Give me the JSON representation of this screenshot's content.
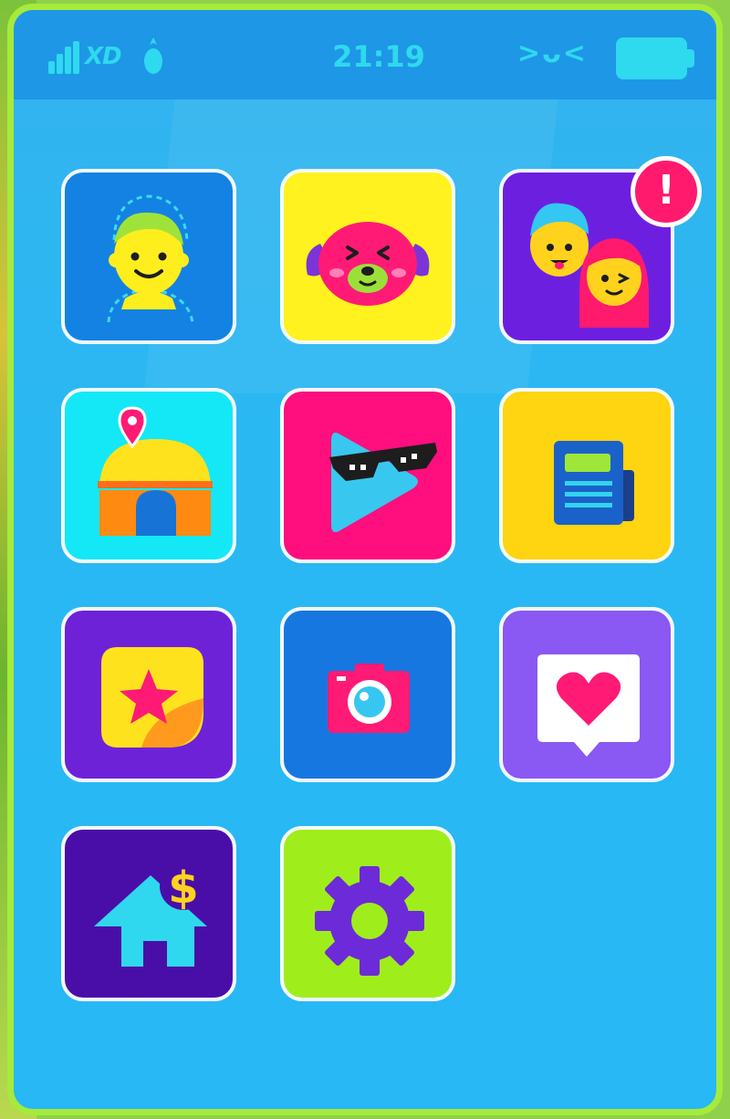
{
  "status_bar": {
    "carrier": "XD",
    "time": "21:19",
    "face": ">ᴗ<",
    "icons": [
      "signal-icon",
      "pineapple-icon",
      "battery-icon"
    ]
  },
  "apps": [
    {
      "name": "avatar-creator",
      "icon": "face-outline-icon",
      "bg": "#1482e2"
    },
    {
      "name": "pets",
      "icon": "pink-dog-icon",
      "bg": "#fff21e"
    },
    {
      "name": "friends",
      "icon": "two-kids-icon",
      "bg": "#6d1fe0",
      "badge": "!"
    },
    {
      "name": "house-map",
      "icon": "dome-house-pin-icon",
      "bg": "#14e8f6"
    },
    {
      "name": "video",
      "icon": "play-sunglasses-icon",
      "bg": "#ff0e7e"
    },
    {
      "name": "news",
      "icon": "newspaper-icon",
      "bg": "#ffd410"
    },
    {
      "name": "favorites",
      "icon": "star-sticker-icon",
      "bg": "#6e22d8"
    },
    {
      "name": "camera",
      "icon": "camera-icon",
      "bg": "#1777e0"
    },
    {
      "name": "likes",
      "icon": "heart-bubble-icon",
      "bg": "#8a58f2"
    },
    {
      "name": "real-estate",
      "icon": "house-dollar-icon",
      "bg": "#4a0ea8"
    },
    {
      "name": "settings",
      "icon": "gear-icon",
      "bg": "#9fee1c"
    }
  ],
  "colors": {
    "screen": "#27b8f5",
    "status_bar": "#1e97e6",
    "frame": "#a6ea3c",
    "status_glyph": "#2fd9ee"
  }
}
